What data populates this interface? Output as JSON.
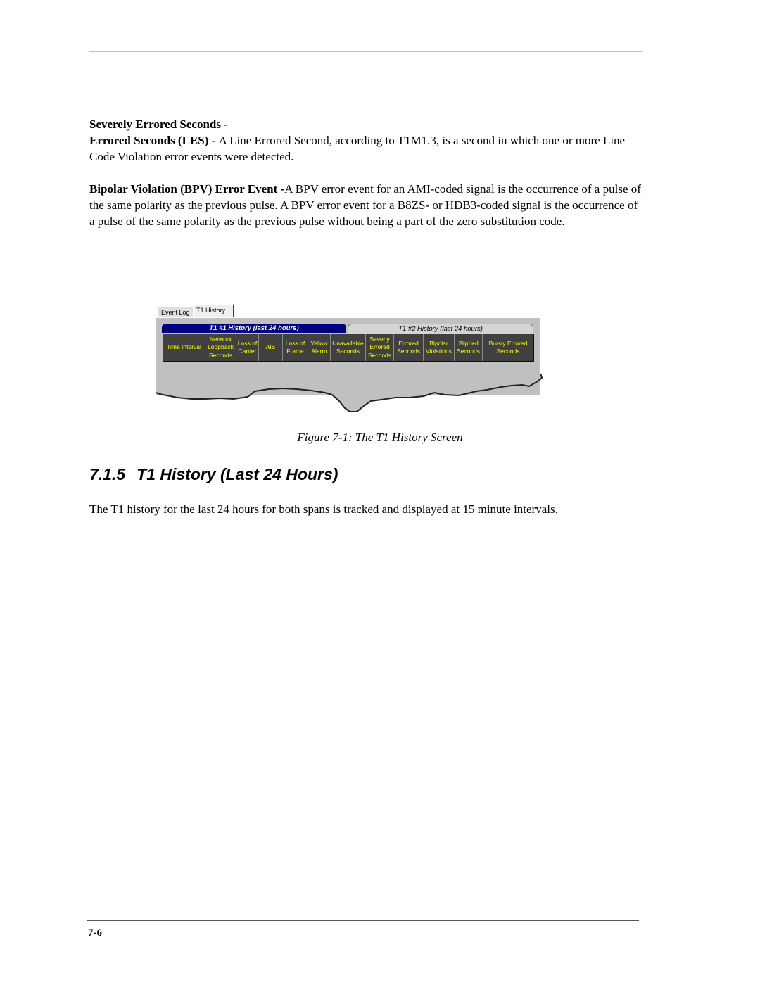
{
  "document": {
    "paragraphs": [
      {
        "lines": [
          {
            "bold": "Severely Errored Seconds -",
            "text": ""
          },
          {
            "bold": "Errored Seconds (LES) - ",
            "text": "A Line Errored Second, according to T1M1.3, is a second in which one or more Line Code Violation error events were detected."
          }
        ]
      },
      {
        "bold": "Bipolar Violation (BPV) Error Event -",
        "text": "A BPV error event for an AMI-coded signal is the occurrence of a pulse of the same polarity as the previous pulse. A BPV error event for a B8ZS- or HDB3-coded signal is the occurrence of a pulse of the same polarity as the previous pulse without being a part of the zero substitution code."
      }
    ],
    "figure_caption": "Figure 7-1: The T1 History Screen",
    "section": {
      "number": "7.1.5",
      "title": "T1 History (Last 24 Hours)"
    },
    "section_text": "The T1 history for the last 24 hours for both spans is tracked and displayed at 15 minute intervals.",
    "page_number": "7-6"
  },
  "screen": {
    "tabs": [
      "Event Log",
      "T1 History"
    ],
    "active_tab": "T1 History",
    "history_tabs": [
      "T1 #1 History (last 24 hours)",
      "T1 #2 History (last 24 hours)"
    ],
    "columns": [
      "Time Interval",
      "Network Loopback Seconds",
      "Loss of Carrier",
      "AIS",
      "Loss of Frame",
      "Yellow Alarm",
      "Unavailable Seconds",
      "Severly Errored Seconds",
      "Errored Seconds",
      "Bipolar Violations",
      "Slipped Seconds",
      "Bursty Errored Seconds"
    ],
    "colors": {
      "header_bg": "#404040",
      "header_text": "#ffff00",
      "active_tab_bg": "#000080",
      "panel_bg": "#c0c0c0"
    }
  }
}
